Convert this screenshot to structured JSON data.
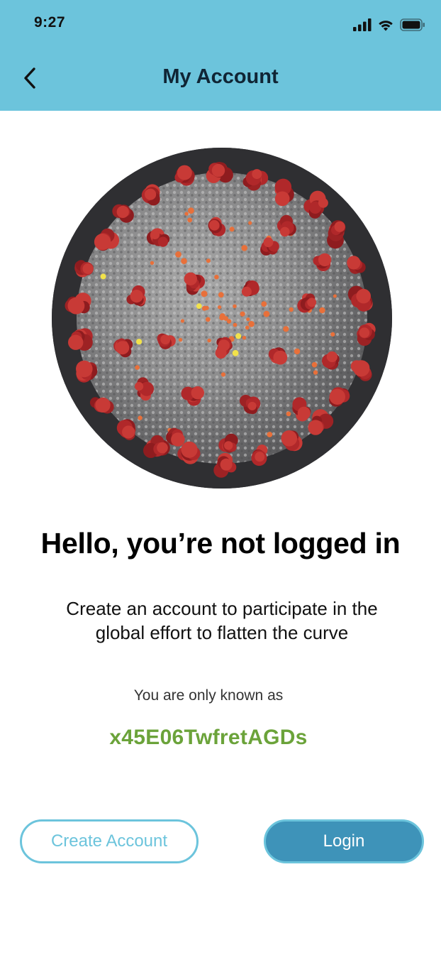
{
  "status_bar": {
    "time": "9:27",
    "icons": [
      "cellular-signal-icon",
      "wifi-icon",
      "battery-icon"
    ]
  },
  "header": {
    "back_icon": "chevron-left-icon",
    "title": "My Account",
    "background_color": "#6cc4dc"
  },
  "hero": {
    "image": "coronavirus-illustration"
  },
  "main": {
    "greeting": "Hello, you’re not logged in",
    "subtitle": "Create an account to participate in the global effort to flatten the curve",
    "known_as_label": "You are only known as",
    "username": "x45E06TwfretAGDs",
    "username_color": "#6ba33a"
  },
  "actions": {
    "create_account_label": "Create Account",
    "login_label": "Login",
    "primary_color": "#3e93b9",
    "accent_color": "#6cc4dc"
  }
}
